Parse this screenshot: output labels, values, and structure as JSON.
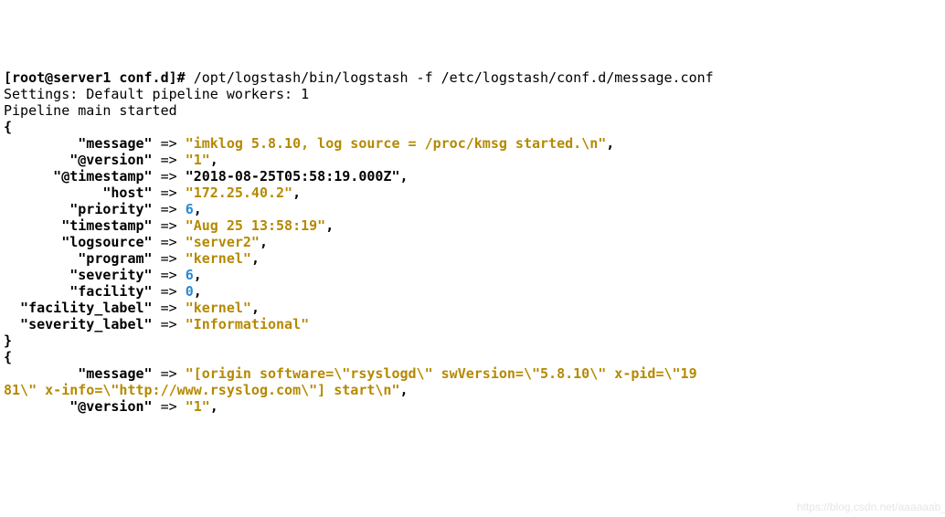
{
  "prompt_user_host": "[root@server1 conf.d]# ",
  "command": "/opt/logstash/bin/logstash -f /etc/logstash/conf.d/message.conf",
  "settings_line": "Settings: Default pipeline workers: 1",
  "pipeline_line": "Pipeline main started",
  "brace_open": "{",
  "brace_close": "}",
  "arrow": " => ",
  "comma": ",",
  "event1": {
    "k_message": "         \"message\"",
    "v_message": "\"imklog 5.8.10, log source = /proc/kmsg started.\\n\"",
    "k_version": "        \"@version\"",
    "v_version": "\"1\"",
    "k_timestamp": "      \"@timestamp\"",
    "v_timestamp": "\"2018-08-25T05:58:19.000Z\"",
    "k_host": "            \"host\"",
    "v_host": "\"172.25.40.2\"",
    "k_priority": "        \"priority\"",
    "v_priority": "6",
    "k_ts": "       \"timestamp\"",
    "v_ts": "\"Aug 25 13:58:19\"",
    "k_logsource": "       \"logsource\"",
    "v_logsource": "\"server2\"",
    "k_program": "         \"program\"",
    "v_program": "\"kernel\"",
    "k_severity": "        \"severity\"",
    "v_severity": "6",
    "k_facility": "        \"facility\"",
    "v_facility": "0",
    "k_facility_label": "  \"facility_label\"",
    "v_facility_label": "\"kernel\"",
    "k_severity_label": "  \"severity_label\"",
    "v_severity_label": "\"Informational\""
  },
  "event2": {
    "k_message": "         \"message\"",
    "v_message_a": "\"[origin software=\\\"rsyslogd\\\" swVersion=\\\"5.8.10\\\" x-pid=\\\"19",
    "v_message_b": "81\\\" x-info=\\\"http://www.rsyslog.com\\\"] start\\n\"",
    "k_version": "        \"@version\"",
    "v_version": "\"1\""
  },
  "watermark": "https://blog.csdn.net/aaaaaab_"
}
